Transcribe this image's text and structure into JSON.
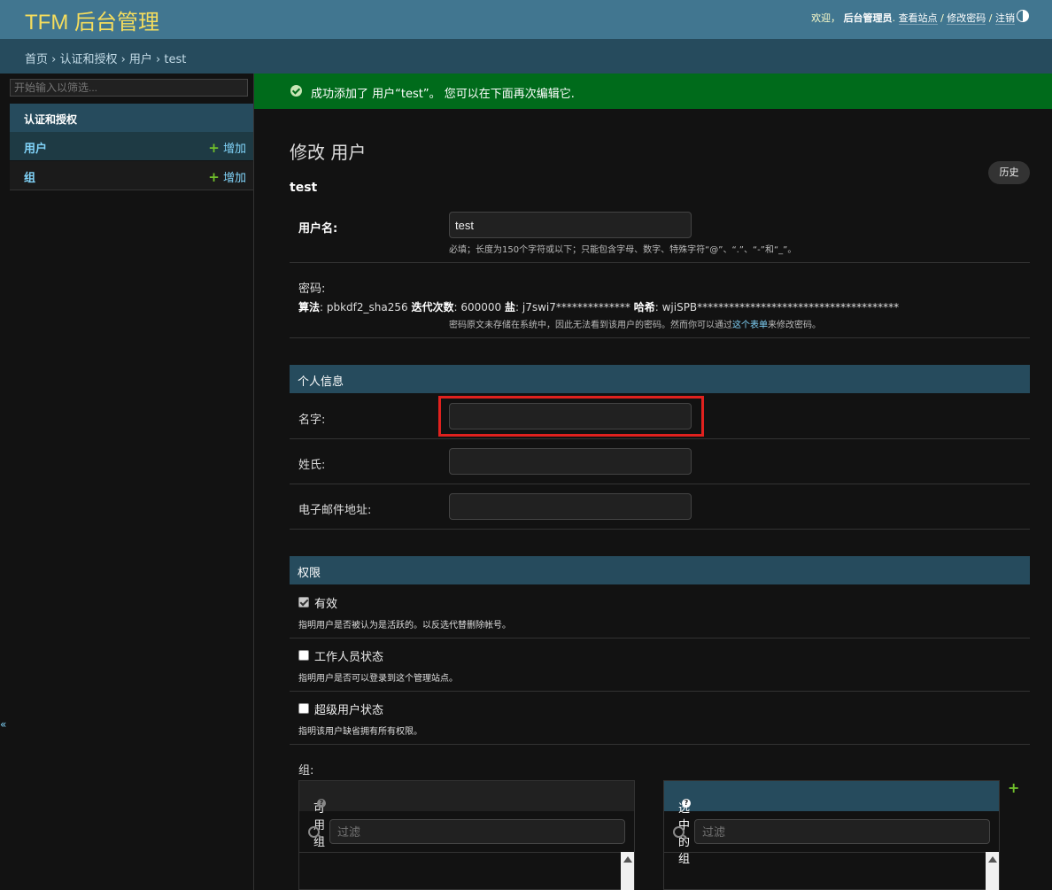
{
  "header": {
    "brand": "TFM 后台管理",
    "welcome": "欢迎，",
    "username": "后台管理员",
    "view_site": "查看站点",
    "change_password": "修改密码",
    "logout": "注销",
    "sep": "/"
  },
  "breadcrumbs": "首页 › 认证和授权 › 用户 › test",
  "sidebar": {
    "filter_placeholder": "开始输入以筛选...",
    "module": "认证和授权",
    "items": [
      {
        "label": "用户",
        "add": "增加"
      },
      {
        "label": "组",
        "add": "增加"
      }
    ],
    "toggle": "«"
  },
  "message": "成功添加了 用户“test”。 您可以在下面再次编辑它.",
  "page": {
    "title": "修改 用户",
    "object": "test",
    "history": "历史"
  },
  "form": {
    "username_label": "用户名:",
    "username_value": "test",
    "username_help": "必填；长度为150个字符或以下；只能包含字母、数字、特殊字符“@”、“.”、“-”和“_”。",
    "password_label": "密码:",
    "algo_label": "算法",
    "algo_value": "pbkdf2_sha256",
    "iter_label": "迭代次数",
    "iter_value": "600000",
    "salt_label": "盐",
    "salt_value": "j7swi7**************",
    "hash_label": "哈希",
    "hash_value": "wjiSPB**************************************",
    "password_help_a": "密码原文未存储在系统中，因此无法看到该用户的密码。然而你可以通过",
    "password_help_link": "这个表单",
    "password_help_b": "来修改密码。",
    "personal_info": "个人信息",
    "first_name_label": "名字:",
    "last_name_label": "姓氏:",
    "email_label": "电子邮件地址:",
    "permissions": "权限",
    "active_label": "有效",
    "active_help": "指明用户是否被认为是活跃的。以反选代替删除帐号。",
    "staff_label": "工作人员状态",
    "staff_help": "指明用户是否可以登录到这个管理站点。",
    "superuser_label": "超级用户状态",
    "superuser_help": "指明该用户缺省拥有所有权限。",
    "groups_label": "组:",
    "available_groups": "可用 组",
    "chosen_groups": "选中的 组",
    "filter_placeholder": "过滤"
  }
}
